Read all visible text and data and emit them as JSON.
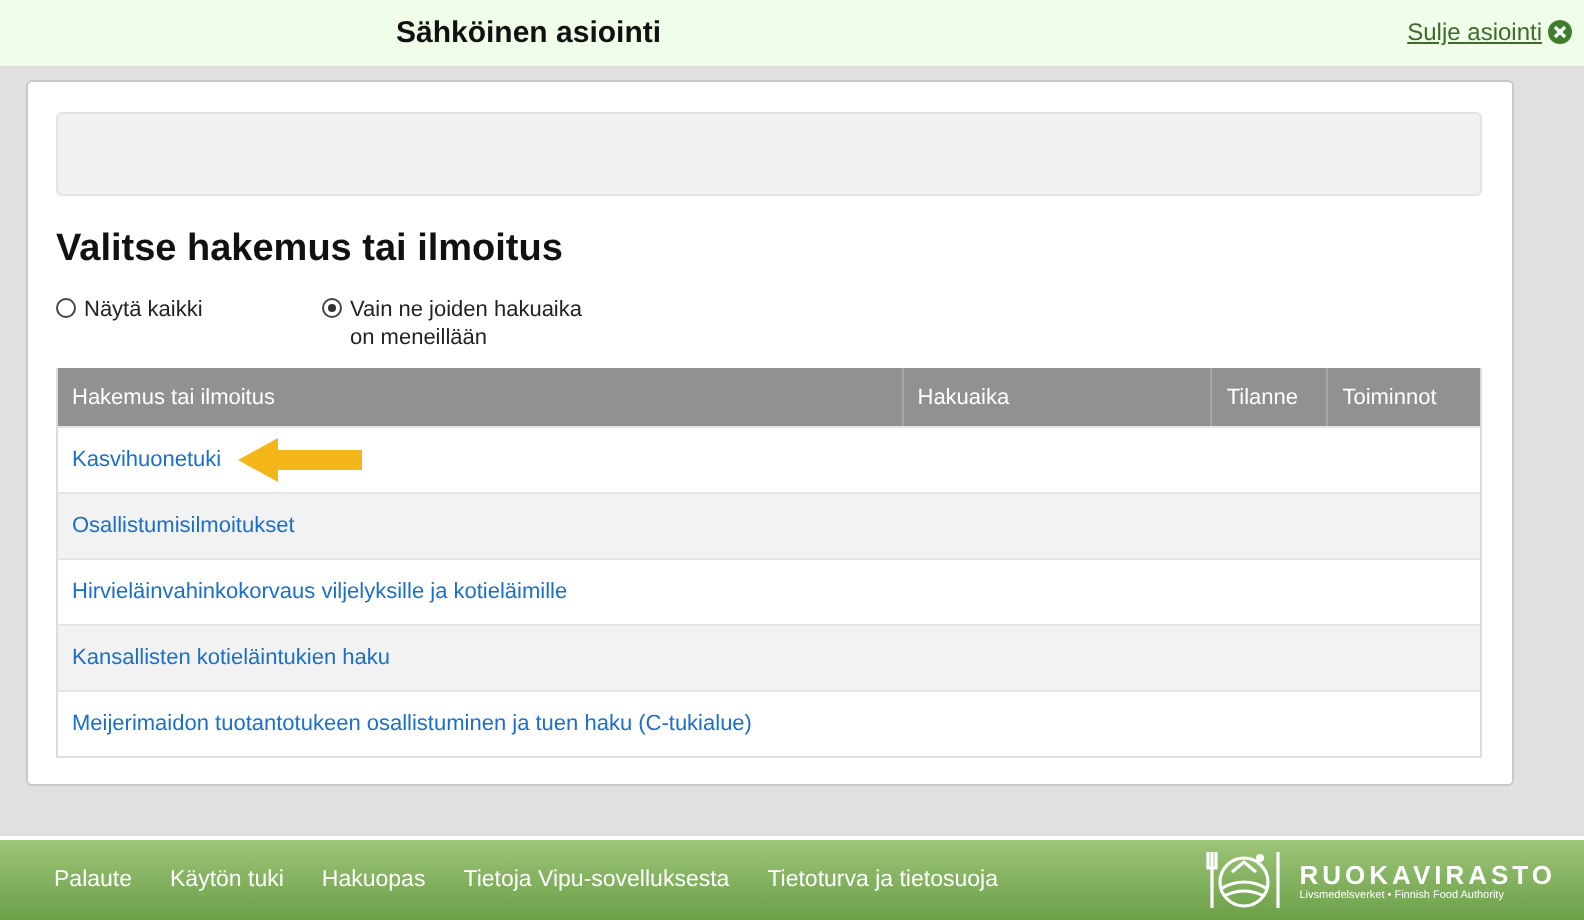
{
  "header": {
    "title": "Sähköinen asiointi",
    "close_link": "Sulje asiointi"
  },
  "page": {
    "heading": "Valitse hakemus tai ilmoitus",
    "filters": [
      {
        "label": "Näytä kaikki",
        "selected": false
      },
      {
        "label": "Vain ne joiden hakuaika on meneillään",
        "selected": true
      }
    ],
    "table": {
      "columns": [
        "Hakemus tai ilmoitus",
        "Hakuaika",
        "Tilanne",
        "Toiminnot"
      ],
      "rows": [
        {
          "name": "Kasvihuonetuki",
          "highlighted": true
        },
        {
          "name": "Osallistumisilmoitukset",
          "highlighted": false
        },
        {
          "name": "Hirvieläinvahinkokorvaus viljelyksille ja kotieläimille",
          "highlighted": false
        },
        {
          "name": "Kansallisten kotieläintukien haku",
          "highlighted": false
        },
        {
          "name": "Meijerimaidon tuotantotukeen osallistuminen ja tuen haku (C-tukialue)",
          "highlighted": false
        }
      ]
    }
  },
  "footer": {
    "links": [
      "Palaute",
      "Käytön tuki",
      "Hakuopas",
      "Tietoja Vipu-sovelluksesta",
      "Tietoturva ja tietosuoja"
    ],
    "logo": {
      "name": "RUOKAVIRASTO",
      "tagline": "Livsmedelsverket • Finnish Food Authority"
    }
  }
}
